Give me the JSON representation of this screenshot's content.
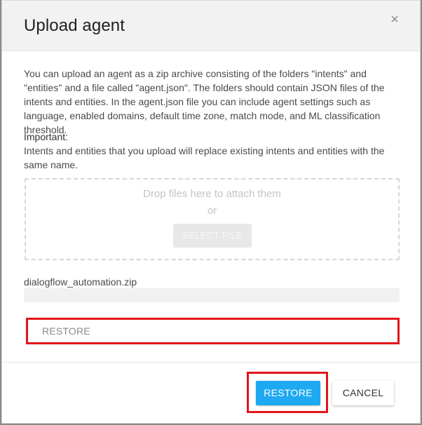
{
  "dialog": {
    "title": "Upload agent",
    "close_glyph": "×",
    "description": "You can upload an agent as a zip archive consisting of the folders \"intents\" and \"entities\" and a file called \"agent.json\". The folders should contain JSON files of the intents and entities. In the agent.json file you can include agent settings such as language, enabled domains, default time zone, match mode, and ML classification threshold.",
    "important_heading": "Important:",
    "important_text": "Intents and entities that you upload will replace existing intents and entities with the same name."
  },
  "dropzone": {
    "drop_text": "Drop files here to attach them",
    "or_text": "or",
    "select_file_label": "SELECT FILE"
  },
  "upload": {
    "file_name": "dialogflow_automation.zip",
    "restore_field_text": "RESTORE"
  },
  "footer": {
    "restore_label": "RESTORE",
    "cancel_label": "CANCEL"
  },
  "colors": {
    "primary": "#1fa9f2",
    "highlight": "#e2141a",
    "header_bg": "#f2f2f2"
  },
  "icons": {
    "close": "close-icon"
  }
}
